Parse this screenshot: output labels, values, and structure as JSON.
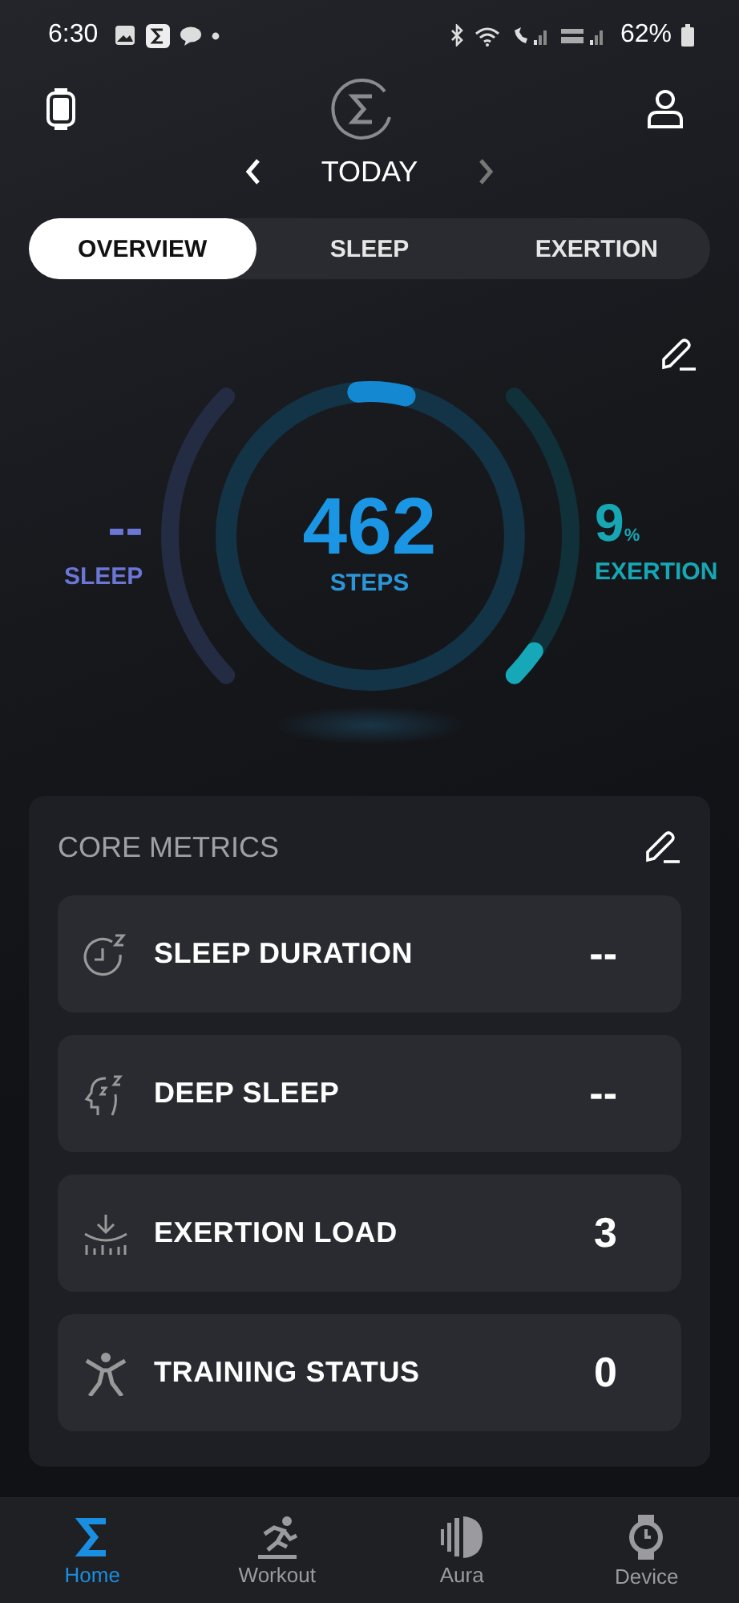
{
  "status_bar": {
    "time": "6:30",
    "battery": "62%"
  },
  "header": {
    "date": "TODAY"
  },
  "tabs": [
    {
      "label": "OVERVIEW",
      "selected": true
    },
    {
      "label": "SLEEP",
      "selected": false
    },
    {
      "label": "EXERTION",
      "selected": false
    }
  ],
  "rings": {
    "sleep": {
      "value": "--",
      "label": "SLEEP"
    },
    "steps": {
      "value": "462",
      "label": "STEPS"
    },
    "exertion": {
      "value": "9",
      "unit": "%",
      "label": "EXERTION"
    }
  },
  "core_metrics": {
    "title": "CORE METRICS",
    "items": [
      {
        "kind": "sleep-duration",
        "label": "SLEEP DURATION",
        "value": "--"
      },
      {
        "kind": "deep-sleep",
        "label": "DEEP SLEEP",
        "value": "--"
      },
      {
        "kind": "exertion-load",
        "label": "EXERTION LOAD",
        "value": "3"
      },
      {
        "kind": "training-status",
        "label": "TRAINING STATUS",
        "value": "0"
      }
    ]
  },
  "nav": [
    {
      "kind": "home",
      "label": "Home",
      "selected": true
    },
    {
      "kind": "workout",
      "label": "Workout",
      "selected": false
    },
    {
      "kind": "aura",
      "label": "Aura",
      "selected": false
    },
    {
      "kind": "device",
      "label": "Device",
      "selected": false
    }
  ]
}
